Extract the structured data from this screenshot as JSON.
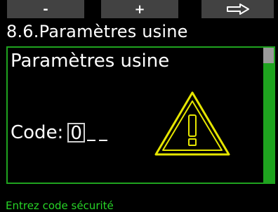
{
  "softkeys": {
    "left_label": "-",
    "middle_label": "+",
    "right_icon": "right-arrow-icon"
  },
  "header": {
    "title": "8.6.Paramètres usine"
  },
  "panel": {
    "title": "Paramètres usine",
    "code_label": "Code:",
    "code_digit": "0",
    "warning_icon": "warning-triangle-icon"
  },
  "status": {
    "text": "Entrez code sécurité"
  },
  "colors": {
    "accent_green": "#1fa31f",
    "status_green": "#27d427",
    "warning_yellow": "#e6e600",
    "softkey_gray": "#424242"
  }
}
